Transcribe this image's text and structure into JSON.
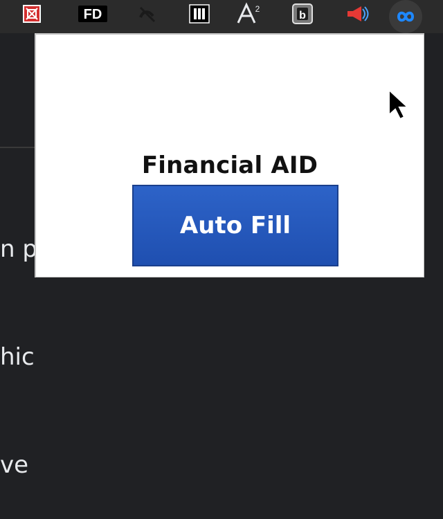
{
  "toolbar": {
    "extensions": [
      {
        "icon": "red-crossed-box-icon"
      },
      {
        "icon": "fd-icon",
        "label": "FD"
      },
      {
        "icon": "slashed-logo-icon"
      },
      {
        "icon": "archive-icon"
      },
      {
        "icon": "font-a-superscript-icon",
        "label": "A²"
      },
      {
        "icon": "b-icon",
        "label": "b"
      },
      {
        "icon": "megaphone-icon"
      },
      {
        "icon": "infinity-link-icon"
      }
    ]
  },
  "page": {
    "lines": [
      "n pr",
      "hich",
      "ve t"
    ]
  },
  "popup": {
    "title": "Financial AID",
    "button_label": "Auto Fill"
  },
  "colors": {
    "button_bg": "#2458BD",
    "toolbar_bg": "#2B2B2B",
    "page_bg": "#202124"
  }
}
